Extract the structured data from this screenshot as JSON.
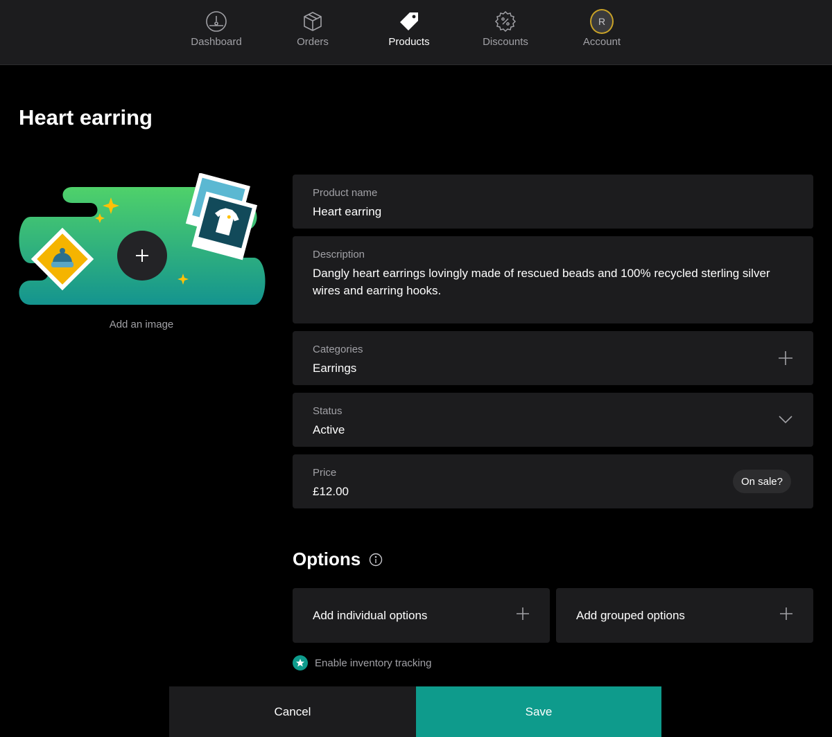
{
  "nav": {
    "items": [
      {
        "label": "Dashboard",
        "icon": "gauge-icon"
      },
      {
        "label": "Orders",
        "icon": "box-icon"
      },
      {
        "label": "Products",
        "icon": "tag-icon",
        "active": true
      },
      {
        "label": "Discounts",
        "icon": "percent-badge-icon"
      },
      {
        "label": "Account",
        "icon": "avatar",
        "avatar_initial": "R"
      }
    ]
  },
  "page": {
    "title": "Heart earring"
  },
  "image": {
    "add_label": "Add an image"
  },
  "fields": {
    "product_name": {
      "label": "Product name",
      "value": "Heart earring"
    },
    "description": {
      "label": "Description",
      "value": "Dangly heart earrings lovingly made of rescued beads and 100% recycled sterling silver wires and earring hooks."
    },
    "categories": {
      "label": "Categories",
      "value": "Earrings"
    },
    "status": {
      "label": "Status",
      "value": "Active"
    },
    "price": {
      "label": "Price",
      "value": "£12.00",
      "sale_button": "On sale?"
    }
  },
  "options": {
    "heading": "Options",
    "individual": "Add individual options",
    "grouped": "Add grouped options",
    "inventory_label": "Enable inventory tracking"
  },
  "actions": {
    "cancel": "Cancel",
    "save": "Save"
  },
  "colors": {
    "accent": "#0e9b8c",
    "surface": "#1c1c1e",
    "background": "#000000",
    "avatar_ring": "#c9a227"
  }
}
